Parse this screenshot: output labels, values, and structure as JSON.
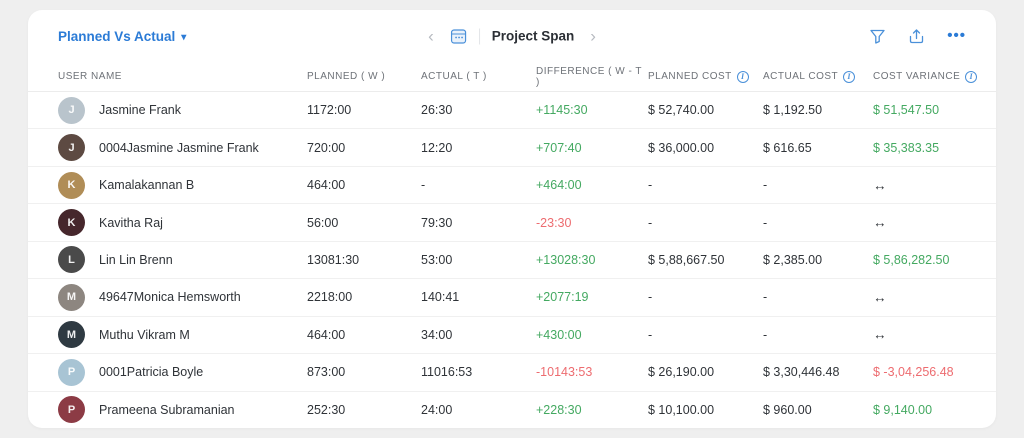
{
  "toolbar": {
    "report_selector": "Planned Vs Actual",
    "caret": "▾",
    "prev": "‹",
    "next": "›",
    "period_label": "Project Span",
    "more_label": "•••"
  },
  "colors": {
    "accent_blue": "#2b7bd6",
    "positive_green": "#44a961",
    "negative_red": "#ed6c70"
  },
  "table": {
    "columns": [
      "USER NAME",
      "PLANNED ( W )",
      "ACTUAL ( T )",
      "DIFFERENCE ( W - T )",
      "PLANNED COST",
      "ACTUAL COST",
      "COST VARIANCE"
    ],
    "rows": [
      {
        "name": "Jasmine Frank",
        "avatar_initial": "J",
        "avatar_color": "#b9c4cc",
        "planned": "1172:00",
        "actual": "26:30",
        "difference": "+1145:30",
        "difference_tone": "pos",
        "planned_cost": "$ 52,740.00",
        "actual_cost": "$ 1,192.50",
        "variance": "$ 51,547.50",
        "variance_tone": "pos"
      },
      {
        "name": "0004Jasmine Jasmine Frank",
        "avatar_initial": "J",
        "avatar_color": "#5d4a42",
        "planned": "720:00",
        "actual": "12:20",
        "difference": "+707:40",
        "difference_tone": "pos",
        "planned_cost": "$ 36,000.00",
        "actual_cost": "$ 616.65",
        "variance": "$ 35,383.35",
        "variance_tone": "pos"
      },
      {
        "name": "Kamalakannan B",
        "avatar_initial": "K",
        "avatar_color": "#b08d57",
        "planned": "464:00",
        "actual": "-",
        "difference": "+464:00",
        "difference_tone": "pos",
        "planned_cost": "-",
        "actual_cost": "-",
        "variance": "↔",
        "variance_tone": "neutral"
      },
      {
        "name": "Kavitha Raj",
        "avatar_initial": "K",
        "avatar_color": "#46272c",
        "planned": "56:00",
        "actual": "79:30",
        "difference": "-23:30",
        "difference_tone": "neg",
        "planned_cost": "-",
        "actual_cost": "-",
        "variance": "↔",
        "variance_tone": "neutral"
      },
      {
        "name": "Lin Lin Brenn",
        "avatar_initial": "L",
        "avatar_color": "#4a4a4a",
        "planned": "13081:30",
        "actual": "53:00",
        "difference": "+13028:30",
        "difference_tone": "pos",
        "planned_cost": "$ 5,88,667.50",
        "actual_cost": "$ 2,385.00",
        "variance": "$ 5,86,282.50",
        "variance_tone": "pos"
      },
      {
        "name": "49647Monica Hemsworth",
        "avatar_initial": "M",
        "avatar_color": "#8d8680",
        "planned": "2218:00",
        "actual": "140:41",
        "difference": "+2077:19",
        "difference_tone": "pos",
        "planned_cost": "-",
        "actual_cost": "-",
        "variance": "↔",
        "variance_tone": "neutral"
      },
      {
        "name": "Muthu Vikram M",
        "avatar_initial": "M",
        "avatar_color": "#2f3a42",
        "planned": "464:00",
        "actual": "34:00",
        "difference": "+430:00",
        "difference_tone": "pos",
        "planned_cost": "-",
        "actual_cost": "-",
        "variance": "↔",
        "variance_tone": "neutral"
      },
      {
        "name": "0001Patricia Boyle",
        "avatar_initial": "P",
        "avatar_color": "#a8c4d4",
        "planned": "873:00",
        "actual": "11016:53",
        "difference": "-10143:53",
        "difference_tone": "neg",
        "planned_cost": "$ 26,190.00",
        "actual_cost": "$ 3,30,446.48",
        "variance": "$ -3,04,256.48",
        "variance_tone": "neg"
      },
      {
        "name": "Prameena Subramanian",
        "avatar_initial": "P",
        "avatar_color": "#8c3b45",
        "planned": "252:30",
        "actual": "24:00",
        "difference": "+228:30",
        "difference_tone": "pos",
        "planned_cost": "$ 10,100.00",
        "actual_cost": "$ 960.00",
        "variance": "$ 9,140.00",
        "variance_tone": "pos"
      }
    ]
  }
}
